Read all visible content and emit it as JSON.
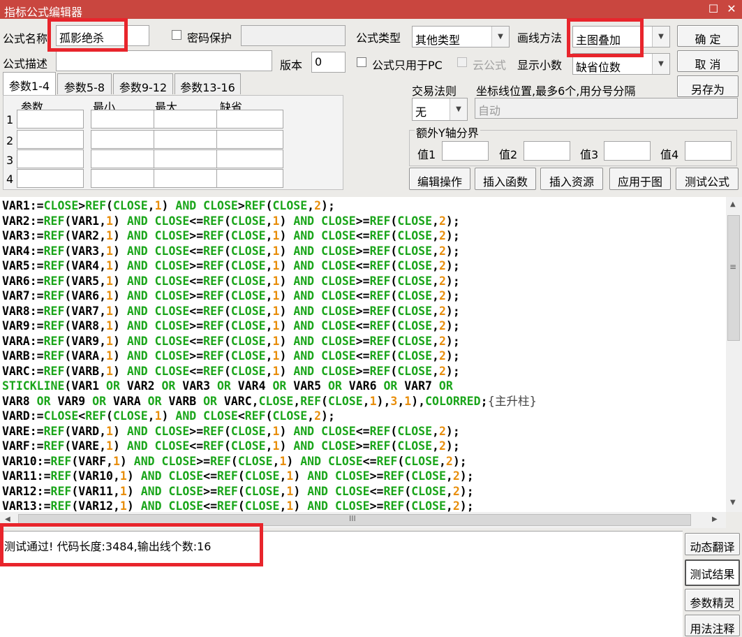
{
  "window": {
    "title": "指标公式编辑器",
    "restore_glyph": "☐",
    "close_glyph": "✕"
  },
  "form": {
    "name_label": "公式名称",
    "name_value": "孤影绝杀",
    "password_label": "密码保护",
    "type_label": "公式类型",
    "type_value": "其他类型",
    "draw_label": "画线方法",
    "draw_value": "主图叠加",
    "desc_label": "公式描述",
    "desc_value": "",
    "version_label": "版本",
    "version_value": "0",
    "pc_only_label": "公式只用于PC",
    "cloud_label": "云公式",
    "decimals_label": "显示小数",
    "decimals_value": "缺省位数"
  },
  "buttons": {
    "ok": "确 定",
    "cancel": "取 消",
    "save_as": "另存为"
  },
  "tabs": [
    "参数1-4",
    "参数5-8",
    "参数9-12",
    "参数13-16"
  ],
  "params": {
    "headers": [
      "参数",
      "最小",
      "最大",
      "缺省"
    ],
    "rows": [
      "1",
      "2",
      "3",
      "4"
    ]
  },
  "trade": {
    "rule_label": "交易法则",
    "rule_value": "无",
    "coord_label": "坐标线位置,最多6个,用分号分隔",
    "coord_value": "自动"
  },
  "yaxis": {
    "group_label": "额外Y轴分界",
    "labels": [
      "值1",
      "值2",
      "值3",
      "值4"
    ]
  },
  "actions": [
    "编辑操作",
    "插入函数",
    "插入资源",
    "应用于图",
    "测试公式"
  ],
  "code_lines": [
    "VAR1:=CLOSE>REF(CLOSE,1) AND CLOSE>REF(CLOSE,2);",
    "VAR2:=REF(VAR1,1) AND CLOSE<=REF(CLOSE,1) AND CLOSE>=REF(CLOSE,2);",
    "VAR3:=REF(VAR2,1) AND CLOSE>=REF(CLOSE,1) AND CLOSE<=REF(CLOSE,2);",
    "VAR4:=REF(VAR3,1) AND CLOSE<=REF(CLOSE,1) AND CLOSE>=REF(CLOSE,2);",
    "VAR5:=REF(VAR4,1) AND CLOSE>=REF(CLOSE,1) AND CLOSE<=REF(CLOSE,2);",
    "VAR6:=REF(VAR5,1) AND CLOSE<=REF(CLOSE,1) AND CLOSE>=REF(CLOSE,2);",
    "VAR7:=REF(VAR6,1) AND CLOSE>=REF(CLOSE,1) AND CLOSE<=REF(CLOSE,2);",
    "VAR8:=REF(VAR7,1) AND CLOSE<=REF(CLOSE,1) AND CLOSE>=REF(CLOSE,2);",
    "VAR9:=REF(VAR8,1) AND CLOSE>=REF(CLOSE,1) AND CLOSE<=REF(CLOSE,2);",
    "VARA:=REF(VAR9,1) AND CLOSE<=REF(CLOSE,1) AND CLOSE>=REF(CLOSE,2);",
    "VARB:=REF(VARA,1) AND CLOSE>=REF(CLOSE,1) AND CLOSE<=REF(CLOSE,2);",
    "VARC:=REF(VARB,1) AND CLOSE<=REF(CLOSE,1) AND CLOSE>=REF(CLOSE,2);",
    "STICKLINE(VAR1 OR VAR2 OR VAR3 OR VAR4 OR VAR5 OR VAR6 OR VAR7 OR",
    "VAR8 OR VAR9 OR VARA OR VARB OR VARC,CLOSE,REF(CLOSE,1),3,1),COLORRED;{主升柱}",
    "VARD:=CLOSE<REF(CLOSE,1) AND CLOSE<REF(CLOSE,2);",
    "VARE:=REF(VARD,1) AND CLOSE>=REF(CLOSE,1) AND CLOSE<=REF(CLOSE,2);",
    "VARF:=REF(VARE,1) AND CLOSE<=REF(CLOSE,1) AND CLOSE>=REF(CLOSE,2);",
    "VAR10:=REF(VARF,1) AND CLOSE>=REF(CLOSE,1) AND CLOSE<=REF(CLOSE,2);",
    "VAR11:=REF(VAR10,1) AND CLOSE<=REF(CLOSE,1) AND CLOSE>=REF(CLOSE,2);",
    "VAR12:=REF(VAR11,1) AND CLOSE>=REF(CLOSE,1) AND CLOSE<=REF(CLOSE,2);",
    "VAR13:=REF(VAR12,1) AND CLOSE<=REF(CLOSE,1) AND CLOSE>=REF(CLOSE,2);"
  ],
  "status": {
    "message": "测试通过! 代码长度:3484,输出线个数:16"
  },
  "side_buttons": [
    "动态翻译",
    "测试结果",
    "参数精灵",
    "用法注释"
  ],
  "icons": {
    "up": "▲",
    "down": "▼",
    "left": "◀",
    "right": "▶",
    "combo_arrow": "▼",
    "scroll_grip": "≡",
    "hscroll_grip": "III"
  },
  "colors": {
    "titlebar": "#c9463f",
    "keyword": "#1aa51a",
    "number": "#e88e0c",
    "highlight_box": "#e8252c"
  }
}
